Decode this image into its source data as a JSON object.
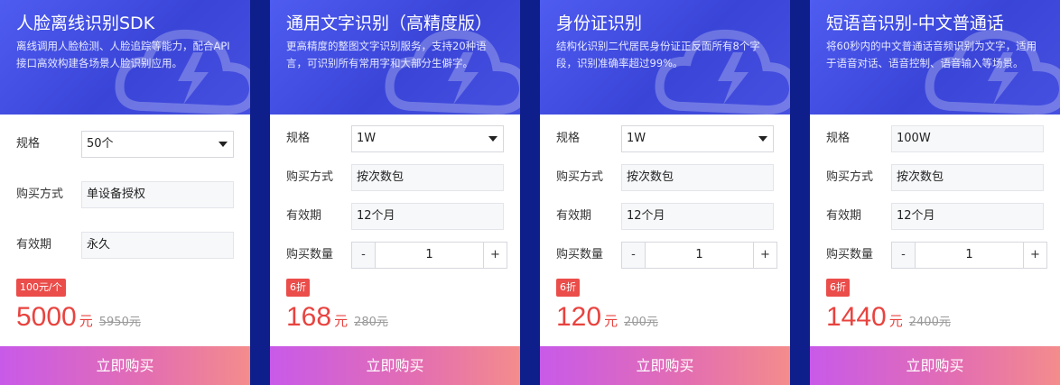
{
  "cards": [
    {
      "title": "人脸离线识别SDK",
      "desc": "离线调用人脸检测、人脸追踪等能力，配合API接口高效构建各场景人脸识别应用。",
      "spec_label": "规格",
      "spec_value": "50个",
      "method_label": "购买方式",
      "method_value": "单设备授权",
      "validity_label": "有效期",
      "validity_value": "永久",
      "badge": "100元/个",
      "price": "5000",
      "unit": "元",
      "orig_price": "5950元",
      "buy_label": "立即购买"
    },
    {
      "title": "通用文字识别（高精度版）",
      "desc": "更高精度的整图文字识别服务，支持20种语言，可识别所有常用字和大部分生僻字。",
      "spec_label": "规格",
      "spec_value": "1W",
      "method_label": "购买方式",
      "method_value": "按次数包",
      "validity_label": "有效期",
      "validity_value": "12个月",
      "qty_label": "购买数量",
      "qty_minus": "-",
      "qty_value": "1",
      "qty_plus": "+",
      "badge": "6折",
      "price": "168",
      "unit": "元",
      "orig_price": "280元",
      "buy_label": "立即购买"
    },
    {
      "title": "身份证识别",
      "desc": "结构化识别二代居民身份证正反面所有8个字段，识别准确率超过99%。",
      "spec_label": "规格",
      "spec_value": "1W",
      "method_label": "购买方式",
      "method_value": "按次数包",
      "validity_label": "有效期",
      "validity_value": "12个月",
      "qty_label": "购买数量",
      "qty_minus": "-",
      "qty_value": "1",
      "qty_plus": "+",
      "badge": "6折",
      "price": "120",
      "unit": "元",
      "orig_price": "200元",
      "buy_label": "立即购买"
    },
    {
      "title": "短语音识别-中文普通话",
      "desc": "将60秒内的中文普通话音频识别为文字，适用于语音对话、语音控制、语音输入等场景。",
      "spec_label": "规格",
      "spec_value": "100W",
      "method_label": "购买方式",
      "method_value": "按次数包",
      "validity_label": "有效期",
      "validity_value": "12个月",
      "qty_label": "购买数量",
      "qty_minus": "-",
      "qty_value": "1",
      "qty_plus": "+",
      "badge": "6折",
      "price": "1440",
      "unit": "元",
      "orig_price": "2400元",
      "buy_label": "立即购买"
    }
  ],
  "colors": {
    "background": "#0e1f8c",
    "header": "#4150e0",
    "price": "#e8433f",
    "badge": "#ea4d4a",
    "button_start": "#c85ae9",
    "button_end": "#f48c8c"
  }
}
